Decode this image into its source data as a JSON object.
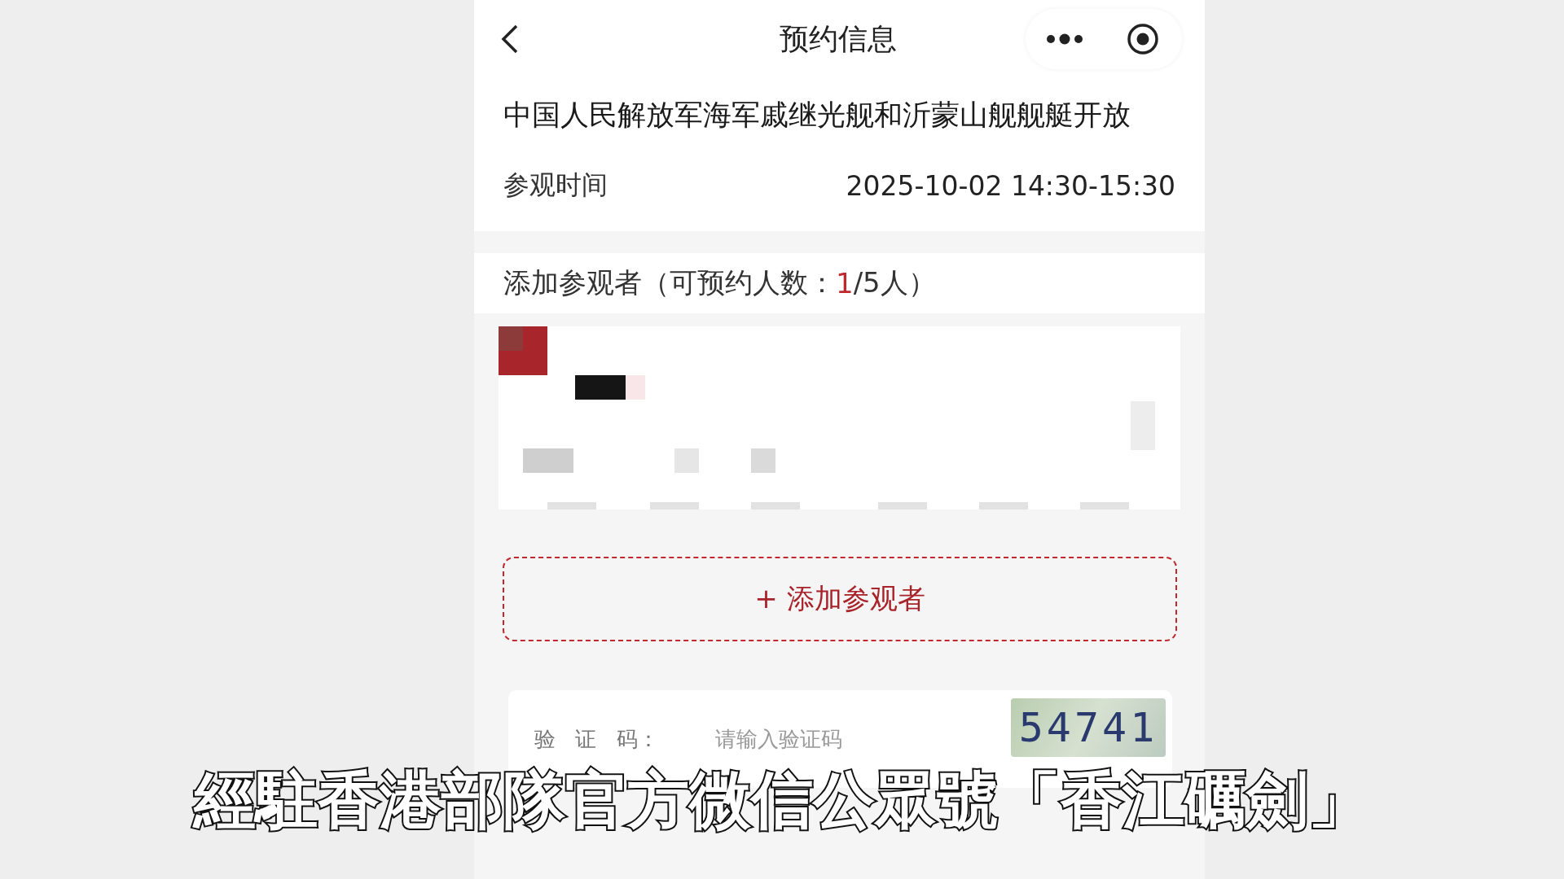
{
  "header": {
    "title": "预约信息"
  },
  "event": {
    "title": "中国人民解放军海军戚继光舰和沂蒙山舰舰艇开放",
    "visit_time_label": "参观时间",
    "visit_time": "2025-10-02 14:30-15:30"
  },
  "visitors": {
    "label_prefix": "添加参观者（可预约人数：",
    "booked": "1",
    "label_suffix": "/5人）",
    "add_button": "+ 添加参观者"
  },
  "captcha": {
    "label": "验 证 码：",
    "placeholder": "请输入验证码",
    "image_code": "54741"
  },
  "subtitle": "經駐香港部隊官方微信公眾號「香江礪劍」"
}
